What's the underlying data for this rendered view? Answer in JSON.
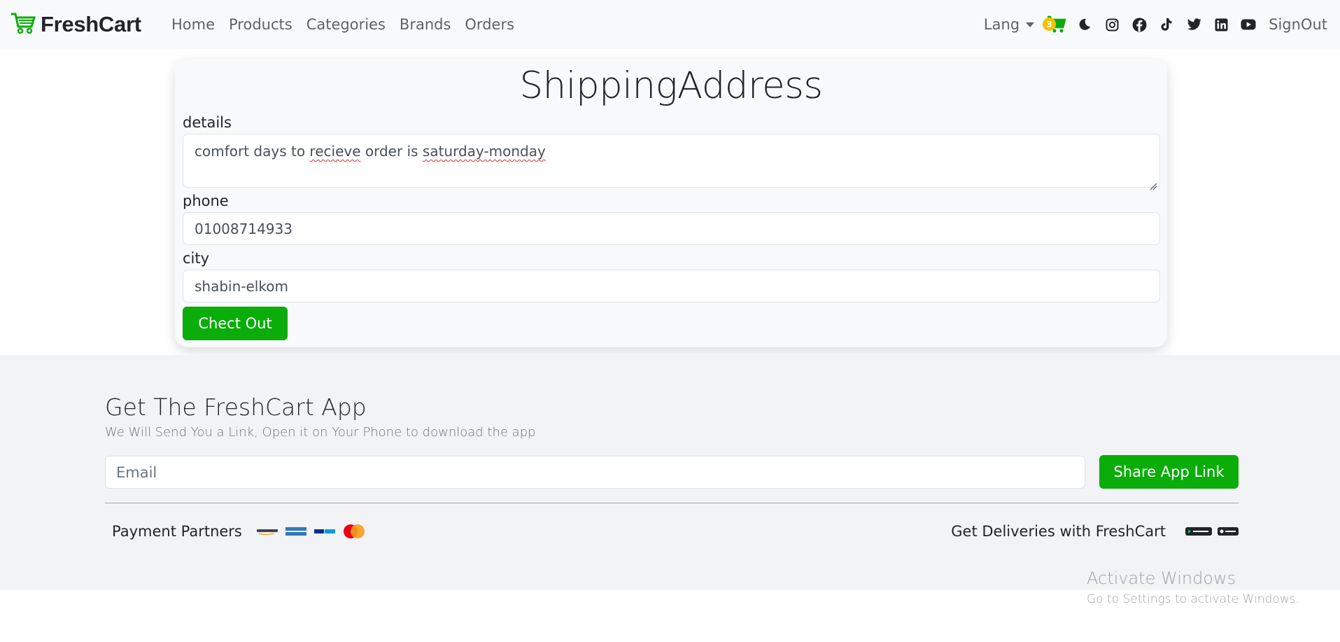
{
  "navbar": {
    "brand": "FreshCart",
    "links": [
      "Home",
      "Products",
      "Categories",
      "Brands",
      "Orders"
    ],
    "lang_label": "Lang",
    "cart_count": "3",
    "signout_label": "SignOut",
    "icons": [
      "moon-icon",
      "instagram-icon",
      "facebook-icon",
      "tiktok-icon",
      "twitter-icon",
      "linkedin-icon",
      "youtube-icon"
    ]
  },
  "form": {
    "title": "ShippingAddress",
    "details_label": "details",
    "details_value_parts": [
      "comfort days to ",
      "recieve",
      " order is ",
      "saturday-monday"
    ],
    "phone_label": "phone",
    "phone_value": "01008714933",
    "city_label": "city",
    "city_value": "shabin-elkom",
    "submit_label": "Chect Out"
  },
  "footer": {
    "title": "Get The FreshCart App",
    "subtitle": "We Will Send You a Link, Open it on Your Phone to download the app",
    "email_placeholder": "Email",
    "share_label": "Share App Link",
    "payment_label": "Payment Partners",
    "payment_logos": [
      "amazon-pay-logo",
      "american-express-logo",
      "paypal-logo",
      "mastercard-logo"
    ],
    "deliveries_label": "Get Deliveries with FreshCart",
    "store_badges": [
      "google-play-badge",
      "app-store-badge"
    ]
  },
  "watermark": {
    "line1": "Activate Windows",
    "line2": "Go to Settings to activate Windows."
  },
  "colors": {
    "brand_green": "#0aad0a",
    "navbar_bg": "#f8f9fa",
    "footer_bg": "#f1f3f5",
    "badge_yellow": "#f2c200"
  }
}
